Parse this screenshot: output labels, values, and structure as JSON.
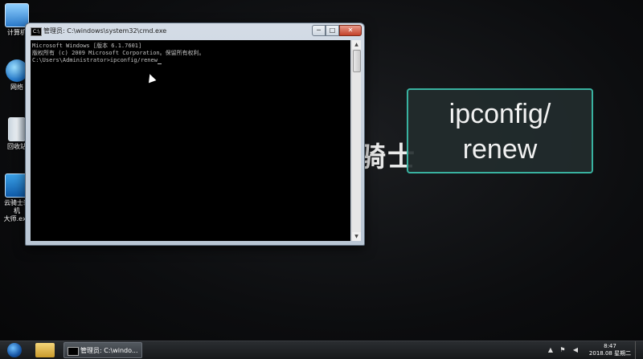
{
  "desktop": {
    "icons": [
      {
        "label": "计算机",
        "icon": "computer-icon"
      },
      {
        "label": "网络",
        "icon": "network-icon"
      },
      {
        "label": "回收站",
        "icon": "recycle-bin-icon"
      },
      {
        "label": "云骑士装机\n大师.exe",
        "icon": "app-icon"
      }
    ],
    "background_logo": "骑士"
  },
  "cmd_window": {
    "title": "管理员: C:\\windows\\system32\\cmd.exe",
    "buttons": {
      "minimize": "─",
      "maximize": "□",
      "close": "✕"
    },
    "lines": [
      "Microsoft Windows [版本 6.1.7601]",
      "版权所有 (c) 2009 Microsoft Corporation。保留所有权利。",
      "",
      "C:\\Users\\Administrator>ipconfig/renew"
    ]
  },
  "caption": {
    "line1": "ipconfig/",
    "line2": "renew",
    "border_color": "#39b2a0"
  },
  "taskbar": {
    "cmd_task_label": "管理员: C:\\windo...",
    "clock_time": "8:47",
    "clock_date": "2018.08 星期二"
  }
}
